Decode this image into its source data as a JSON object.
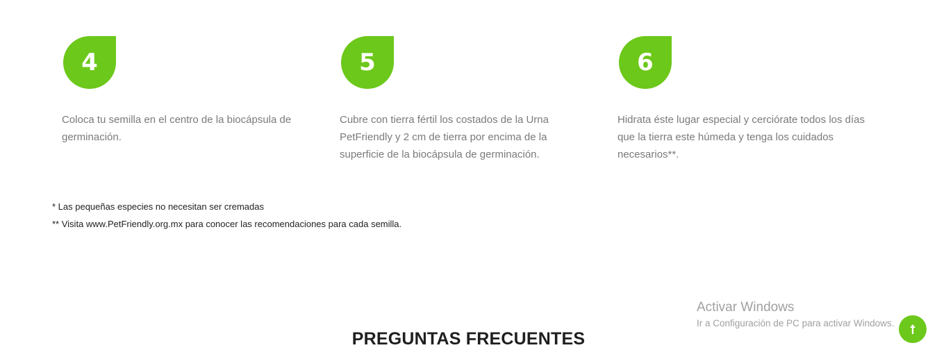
{
  "steps": [
    {
      "number": "4",
      "text": "Coloca tu semilla en el centro de la biocápsula de germinación."
    },
    {
      "number": "5",
      "text": "Cubre con tierra fértil los costados de la Urna PetFriendly y 2 cm de tierra por encima de la superficie de la biocápsula de germinación."
    },
    {
      "number": "6",
      "text": "Hidrata éste lugar especial y cerciórate todos los días que la tierra este húmeda y tenga los cuidados necesarios**."
    }
  ],
  "notes": {
    "note1": "* Las pequeñas especies no necesitan ser cremadas",
    "note2": "** Visita www.PetFriendly.org.mx para conocer las recomendaciones para cada semilla."
  },
  "faq": {
    "title": "PREGUNTAS FRECUENTES"
  },
  "watermark": {
    "title": "Activar Windows",
    "subtitle": "Ir a Configuración de PC para activar Windows."
  },
  "back_to_top": {
    "icon": "arrow-up-icon"
  },
  "colors": {
    "accent": "#6cc81a",
    "body_text": "#7a7a7a"
  }
}
